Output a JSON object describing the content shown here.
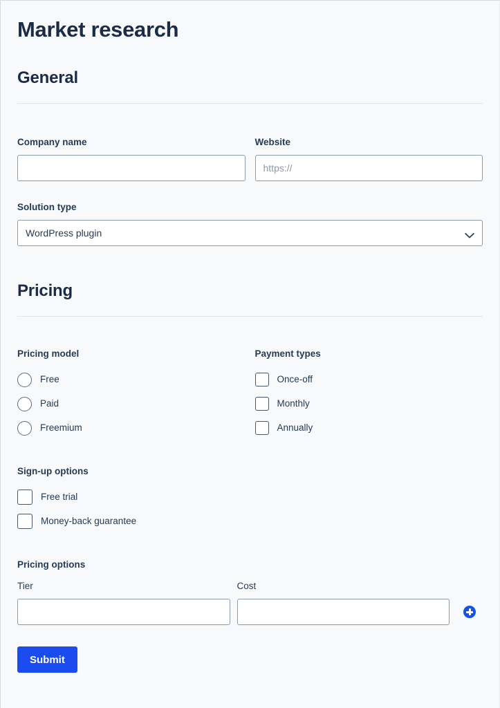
{
  "page": {
    "title": "Market research"
  },
  "sections": {
    "general": {
      "heading": "General",
      "company_name": {
        "label": "Company name",
        "value": "",
        "placeholder": ""
      },
      "website": {
        "label": "Website",
        "value": "",
        "placeholder": "https://"
      },
      "solution_type": {
        "label": "Solution type",
        "selected": "WordPress plugin",
        "chevron_icon": "chevron-down-icon"
      }
    },
    "pricing": {
      "heading": "Pricing",
      "pricing_model": {
        "label": "Pricing model",
        "options": [
          {
            "label": "Free",
            "checked": false
          },
          {
            "label": "Paid",
            "checked": false
          },
          {
            "label": "Freemium",
            "checked": false
          }
        ]
      },
      "payment_types": {
        "label": "Payment types",
        "options": [
          {
            "label": "Once-off",
            "checked": false
          },
          {
            "label": "Monthly",
            "checked": false
          },
          {
            "label": "Annually",
            "checked": false
          }
        ]
      },
      "signup_options": {
        "label": "Sign-up options",
        "options": [
          {
            "label": "Free trial",
            "checked": false
          },
          {
            "label": "Money-back guarantee",
            "checked": false
          }
        ]
      },
      "pricing_options": {
        "label": "Pricing options",
        "tier": {
          "label": "Tier",
          "value": "",
          "placeholder": ""
        },
        "cost": {
          "label": "Cost",
          "value": "",
          "placeholder": ""
        },
        "add_icon": "plus-icon"
      }
    }
  },
  "footer": {
    "submit_label": "Submit"
  },
  "colors": {
    "accent_blue": "#1a4cf0",
    "add_button_blue": "#1652e8",
    "heading_navy": "#1b2c46",
    "text_navy": "#243b56",
    "page_background": "#f8f9fa",
    "input_border": "#8d9bad",
    "rule": "#e3e5e8"
  }
}
